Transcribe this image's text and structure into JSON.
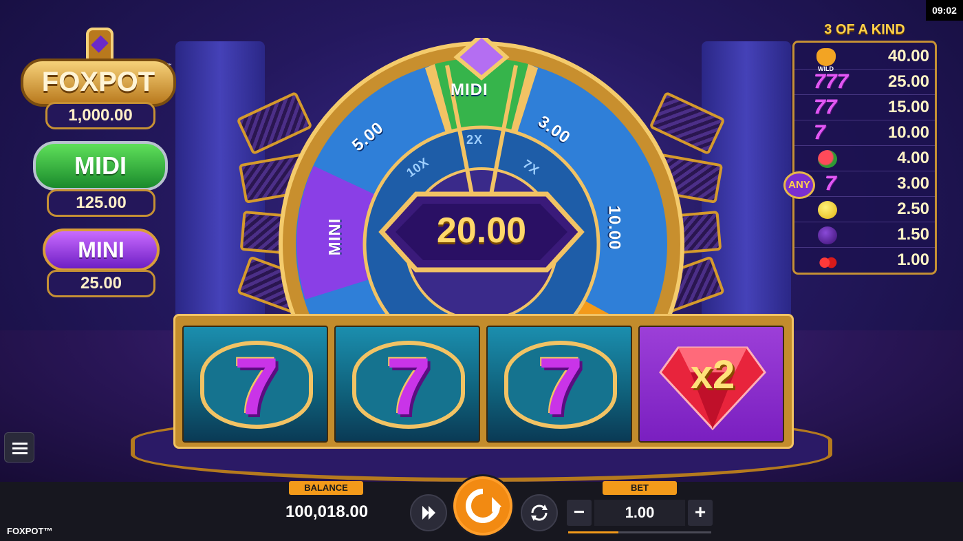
{
  "status": {
    "clock": "09:02"
  },
  "jackpots": {
    "logo_text": "FOXPOT",
    "logo_tm": "™",
    "foxpot_value": "1,000.00",
    "midi_label": "MIDI",
    "midi_value": "125.00",
    "mini_label": "MINI",
    "mini_value": "25.00"
  },
  "wheel": {
    "segments": [
      "MIDI",
      "3.00",
      "10.00",
      "5.00",
      "MINI"
    ],
    "inner_labels": [
      "2X",
      "10X",
      "7X"
    ],
    "center_value": "20.00"
  },
  "paytable": {
    "title": "3 OF A KIND",
    "rows": [
      {
        "symbol": "fox-wild-icon",
        "symbol_text": "WILD",
        "value": "40.00"
      },
      {
        "symbol": "triple-seven-icon",
        "symbol_text": "777",
        "value": "25.00"
      },
      {
        "symbol": "double-seven-icon",
        "symbol_text": "77",
        "value": "15.00"
      },
      {
        "symbol": "seven-icon",
        "symbol_text": "7",
        "value": "10.00"
      },
      {
        "symbol": "watermelon-icon",
        "symbol_text": "",
        "value": "4.00"
      },
      {
        "symbol": "any-seven-icon",
        "symbol_text": "7",
        "badge": "ANY",
        "value": "3.00"
      },
      {
        "symbol": "lemon-icon",
        "symbol_text": "",
        "value": "2.50"
      },
      {
        "symbol": "plum-icon",
        "symbol_text": "",
        "value": "1.50"
      },
      {
        "symbol": "cherry-icon",
        "symbol_text": "",
        "value": "1.00"
      }
    ]
  },
  "reels": {
    "symbols": [
      "7",
      "7",
      "7"
    ],
    "multiplier": "x2"
  },
  "bottom_bar": {
    "brand": "FOXPOT™",
    "balance_label": "BALANCE",
    "balance_value": "100,018.00",
    "bet_label": "BET",
    "bet_value": "1.00",
    "bet_minus": "−",
    "bet_plus": "+",
    "bet_level_fraction": 0.35
  },
  "colors": {
    "accent": "#f28a12",
    "gold": "#c69134",
    "midi_green": "#1a8a2c",
    "mini_purple": "#6e1fc4"
  }
}
